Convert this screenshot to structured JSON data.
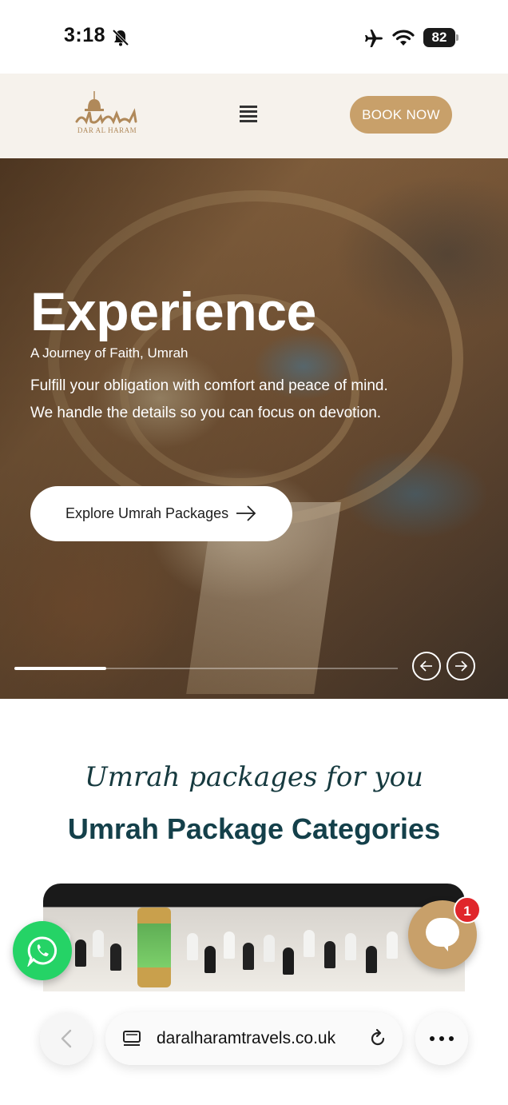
{
  "status_bar": {
    "time": "3:18",
    "battery": "82",
    "icons": [
      "bell-slash-icon",
      "airplane-icon",
      "wifi-icon",
      "battery-icon"
    ]
  },
  "header": {
    "logo_text": "DAR AL HARAM",
    "book_button": "BOOK NOW",
    "menu_icon": "hamburger-icon",
    "brand_color": "#c8a06a",
    "background_color": "#f6f2ec"
  },
  "hero": {
    "title": "Experience",
    "kicker": "A Journey of Faith, Umrah",
    "description": "Fulfill your obligation with comfort and peace of mind. We handle the details so you can focus on devotion.",
    "cta_label": "Explore Umrah Packages",
    "slider_progress": 0.24,
    "prev_icon": "arrow-left-icon",
    "next_icon": "arrow-right-icon"
  },
  "packages": {
    "script_heading": "Umrah packages for you",
    "heading": "Umrah Package Categories",
    "heading_color": "#14404a"
  },
  "widgets": {
    "whatsapp_icon": "whatsapp-icon",
    "whatsapp_color": "#25d366",
    "chat_icon": "chat-bubble-icon",
    "chat_badge": "1"
  },
  "browser": {
    "url": "daralharamtravels.co.uk",
    "back_icon": "chevron-left-icon",
    "reload_icon": "reload-icon",
    "more_icon": "more-dots-icon"
  }
}
